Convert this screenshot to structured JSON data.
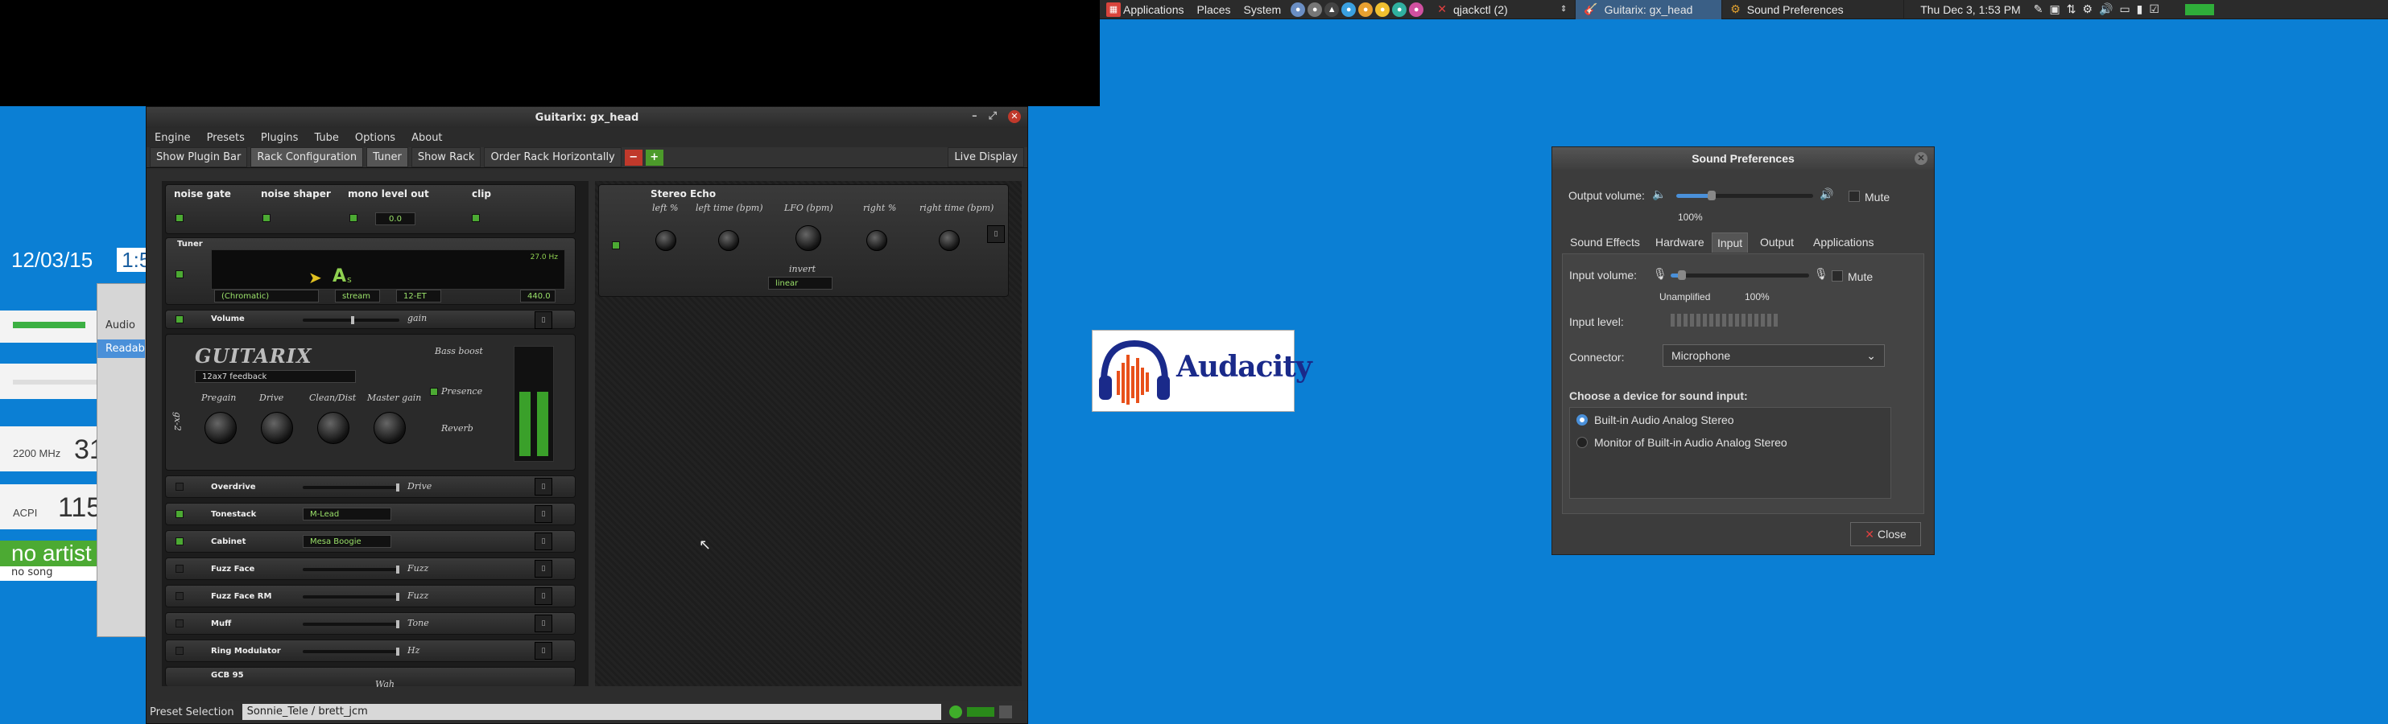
{
  "panel": {
    "menus": [
      "Applications",
      "Places",
      "System"
    ],
    "tasks": [
      {
        "label": "qjackctl (2)",
        "active": false
      },
      {
        "label": "Guitarix: gx_head",
        "active": true
      },
      {
        "label": "Sound Preferences",
        "active": false
      }
    ],
    "clock": "Thu Dec 3,  1:53 PM"
  },
  "desktop": {
    "date": "12/03/15",
    "time_partial": "1:5",
    "audio_title": "Audio",
    "readable": "Readab",
    "cpu_label": "2200 MHz",
    "cpu_partial": "31",
    "acpi_label": "ACPI",
    "acpi_value": "115",
    "artist": "no artist",
    "song": "no song"
  },
  "guitarix": {
    "title": "Guitarix: gx_head",
    "menu": [
      "Engine",
      "Presets",
      "Plugins",
      "Tube",
      "Options",
      "About"
    ],
    "toolbar": {
      "plugin_bar": "Show Plugin Bar",
      "rack_config": "Rack Configuration",
      "tuner": "Tuner",
      "show_rack": "Show Rack",
      "order_rack": "Order Rack Horizontally",
      "minus": "−",
      "plus": "+",
      "live_display": "Live Display"
    },
    "top_units": [
      "noise gate",
      "noise shaper",
      "mono level out",
      "clip"
    ],
    "mono_value": "0.0",
    "tuner": {
      "label": "Tuner",
      "note": "A",
      "sub": "s",
      "freq": "440.0",
      "cents": "27.0 Hz",
      "mode": "(Chromatic)",
      "stream": "stream",
      "temperament": "12-ET"
    },
    "volume": {
      "name": "Volume",
      "param": "gain"
    },
    "amp": {
      "logo": "GUITARIX",
      "model": "12ax7 feedback",
      "side_label": "gx-2",
      "knobs": [
        "Pregain",
        "Drive",
        "Clean/Dist",
        "Master gain"
      ],
      "switches": [
        "Bass boost",
        "Presence",
        "Reverb"
      ]
    },
    "units": [
      {
        "name": "Overdrive",
        "param": "Drive",
        "on": false
      },
      {
        "name": "Tonestack",
        "param": "",
        "combo": "M-Lead",
        "on": true
      },
      {
        "name": "Cabinet",
        "param": "",
        "combo": "Mesa Boogie",
        "on": true
      },
      {
        "name": "Fuzz Face",
        "param": "Fuzz",
        "on": false
      },
      {
        "name": "Fuzz Face RM",
        "param": "Fuzz",
        "on": false
      },
      {
        "name": "Muff",
        "param": "Tone",
        "on": false
      },
      {
        "name": "Ring Modulator",
        "param": "Hz",
        "on": false
      }
    ],
    "gcb": {
      "name": "GCB 95",
      "param": "Wah"
    },
    "echo": {
      "name": "Stereo Echo",
      "knobs": [
        "left %",
        "left time (bpm)",
        "LFO (bpm)",
        "right %",
        "right time (bpm)"
      ],
      "invert_label": "invert",
      "invert_value": "linear"
    },
    "preset_label": "Preset Selection",
    "preset_value": "Sonnie_Tele / brett_jcm"
  },
  "audacity": {
    "name": "Audacity"
  },
  "sound": {
    "title": "Sound Preferences",
    "output_volume": "Output volume:",
    "output_pct": "100%",
    "mute": "Mute",
    "tabs": [
      "Sound Effects",
      "Hardware",
      "Input",
      "Output",
      "Applications"
    ],
    "active_tab": "Input",
    "input_volume": "Input volume:",
    "unamplified": "Unamplified",
    "input_pct": "100%",
    "input_level": "Input level:",
    "connector": "Connector:",
    "connector_value": "Microphone",
    "choose": "Choose a device for sound input:",
    "devices": [
      "Built-in Audio Analog Stereo",
      "Monitor of Built-in Audio Analog Stereo"
    ],
    "close": "Close",
    "output_level_fraction": 0.26,
    "input_level_fraction": 0.08
  },
  "colors": {
    "desktop": "#0b7fd4",
    "accent_green": "#4caa33",
    "tab_active": "#3a5f86"
  }
}
